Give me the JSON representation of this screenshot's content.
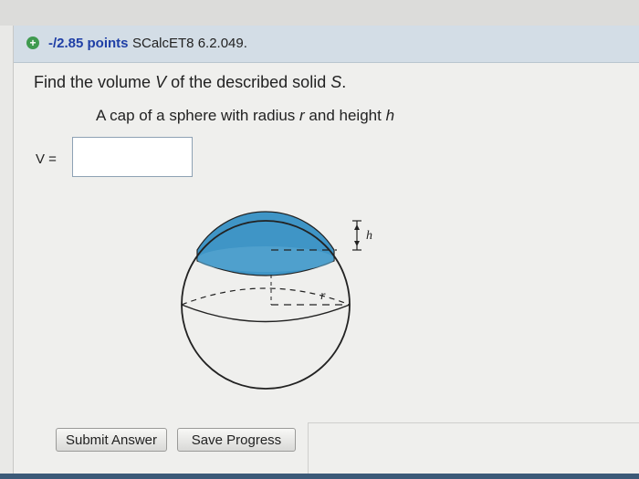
{
  "header": {
    "points": "-/2.85 points",
    "problem_id": "SCalcET8 6.2.049."
  },
  "question": {
    "prefix": "Find the volume ",
    "var_v": "V",
    "middle": " of the described solid ",
    "var_s": "S",
    "suffix": "."
  },
  "description": {
    "prefix": "A cap of a sphere with radius ",
    "var_r": "r",
    "middle": " and height ",
    "var_h": "h"
  },
  "answer": {
    "label": "V =",
    "value": ""
  },
  "figure": {
    "label_h": "h",
    "label_r": "r",
    "cap_color": "#3f95c6"
  },
  "buttons": {
    "submit": "Submit Answer",
    "save": "Save Progress"
  }
}
